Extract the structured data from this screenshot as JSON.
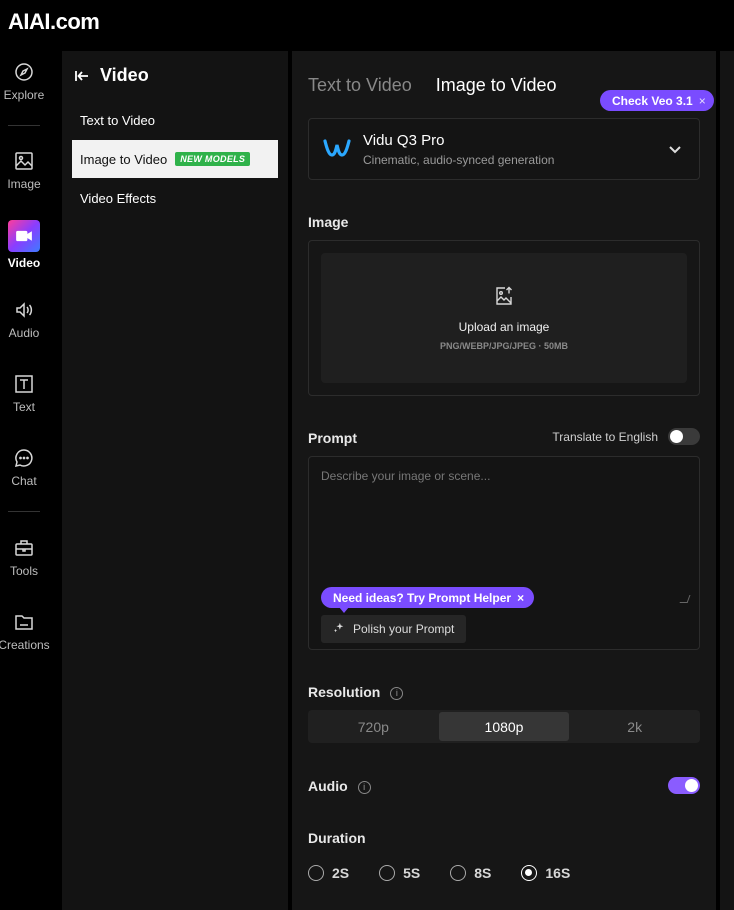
{
  "brand": {
    "logo": "AIAI.com"
  },
  "rail": {
    "items": [
      {
        "label": "Explore",
        "icon": "compass-icon"
      },
      {
        "label": "Image",
        "icon": "image-icon"
      },
      {
        "label": "Video",
        "icon": "video-camera-icon",
        "active": true
      },
      {
        "label": "Audio",
        "icon": "speaker-icon"
      },
      {
        "label": "Text",
        "icon": "text-box-icon"
      },
      {
        "label": "Chat",
        "icon": "chat-bubble-icon"
      },
      {
        "label": "Tools",
        "icon": "toolbox-icon"
      },
      {
        "label": "Creations",
        "icon": "folder-icon"
      }
    ]
  },
  "subnav": {
    "title": "Video",
    "items": [
      {
        "label": "Text to Video"
      },
      {
        "label": "Image to Video",
        "badge": "NEW MODELS",
        "selected": true
      },
      {
        "label": "Video Effects"
      }
    ]
  },
  "main": {
    "tabs": [
      {
        "label": "Text to Video"
      },
      {
        "label": "Image to Video",
        "active": true
      }
    ],
    "promo_pill": {
      "label": "Check Veo 3.1",
      "close": "×"
    },
    "model": {
      "name": "Vidu Q3 Pro",
      "description": "Cinematic, audio-synced generation"
    },
    "image_section": {
      "label": "Image",
      "upload_title": "Upload an image",
      "upload_formats": "PNG/WEBP/JPG/JPEG · 50MB"
    },
    "prompt_section": {
      "label": "Prompt",
      "translate_label": "Translate to English",
      "translate_on": false,
      "placeholder": "Describe your image or scene...",
      "helper_pill": "Need ideas? Try Prompt Helper",
      "helper_close": "×",
      "polish_label": "Polish your Prompt"
    },
    "resolution": {
      "label": "Resolution",
      "options": [
        "720p",
        "1080p",
        "2k"
      ],
      "selected": "1080p"
    },
    "audio": {
      "label": "Audio",
      "enabled": true
    },
    "duration": {
      "label": "Duration",
      "options": [
        "2S",
        "5S",
        "8S",
        "16S"
      ],
      "selected": "16S"
    }
  },
  "colors": {
    "accent": "#7a4cff",
    "badge": "#2fb24a"
  }
}
